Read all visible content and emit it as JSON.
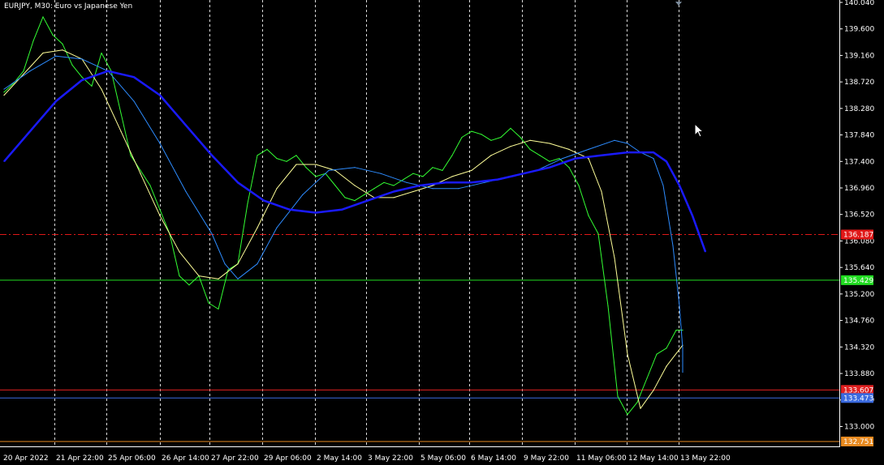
{
  "title": "EURJPY, M30:  Euro vs Japanese Yen",
  "colors": {
    "background": "#000000",
    "axis": "#ffffff",
    "grid": "#ffffff",
    "price": "#33ff33",
    "ma_fast": "#ffff99",
    "ma_mid": "#2d8cff",
    "ma_slow": "#1a1aff",
    "level_red_dash": "#e01818",
    "level_green": "#22dd22",
    "level_red": "#e02020",
    "level_blue": "#3a6adf",
    "level_orange": "#e88a20"
  },
  "chart_data": {
    "type": "line",
    "symbol": "EURJPY",
    "timeframe": "M30",
    "title": "EURJPY, M30:  Euro vs Japanese Yen",
    "ylim": [
      132.67,
      140.08
    ],
    "y_ticks": [
      "140.040",
      "139.600",
      "139.160",
      "138.720",
      "138.280",
      "137.840",
      "137.400",
      "136.960",
      "136.520",
      "136.080",
      "135.640",
      "135.200",
      "134.760",
      "134.320",
      "133.880",
      "133.440",
      "133.000"
    ],
    "x_ticks": [
      "20 Apr 2022",
      "21 Apr 22:00",
      "25 Apr 06:00",
      "26 Apr 14:00",
      "27 Apr 22:00",
      "29 Apr 06:00",
      "2 May 14:00",
      "3 May 22:00",
      "5 May 06:00",
      "6 May 14:00",
      "9 May 22:00",
      "11 May 06:00",
      "12 May 14:00",
      "13 May 22:00"
    ],
    "grid": "vertical-dashed",
    "price_levels": [
      {
        "label": "136.187",
        "value": 136.187,
        "style": "dash-dot",
        "color": "#e01818"
      },
      {
        "label": "135.429",
        "value": 135.429,
        "style": "solid",
        "color": "#22dd22"
      },
      {
        "label": "133.607",
        "value": 133.607,
        "style": "solid",
        "color": "#e02020"
      },
      {
        "label": "133.473",
        "value": 133.473,
        "style": "solid",
        "color": "#3a6adf"
      },
      {
        "label": "132.751",
        "value": 132.751,
        "style": "solid",
        "color": "#e88a20"
      }
    ],
    "series": [
      {
        "role": "price",
        "values": [
          138.55,
          138.7,
          138.9,
          139.4,
          139.8,
          139.5,
          139.35,
          139.0,
          138.8,
          138.65,
          139.2,
          138.9,
          138.2,
          137.5,
          137.25,
          137.0,
          136.6,
          136.2,
          135.5,
          135.35,
          135.5,
          135.05,
          134.95,
          135.6,
          135.7,
          136.7,
          137.5,
          137.6,
          137.45,
          137.4,
          137.5,
          137.3,
          137.15,
          137.2,
          137.0,
          136.8,
          136.75,
          136.85,
          136.95,
          137.05,
          137.0,
          137.1,
          137.2,
          137.15,
          137.3,
          137.25,
          137.5,
          137.8,
          137.9,
          137.85,
          137.75,
          137.8,
          137.95,
          137.8,
          137.6,
          137.5,
          137.4,
          137.45,
          137.3,
          137.0,
          136.5,
          136.2,
          135.0,
          133.5,
          133.2,
          133.4,
          133.8,
          134.2,
          134.3,
          134.6,
          134.6
        ],
        "x_index": [
          0,
          1.5,
          3,
          4.5,
          6,
          7.5,
          9,
          10.5,
          12,
          13.5,
          15,
          16.5,
          18,
          19.5,
          21,
          22.5,
          24,
          25.5,
          27,
          28.5,
          30,
          31.5,
          33,
          34.5,
          36,
          37.5,
          39,
          40.5,
          42,
          43.5,
          45,
          46.5,
          48,
          49.5,
          51,
          52.5,
          54,
          55.5,
          57,
          58.5,
          60,
          61.5,
          63,
          64.5,
          66,
          67.5,
          69,
          70.5,
          72,
          73.5,
          75,
          76.5,
          78,
          79.5,
          81,
          82.5,
          84,
          85.5,
          87,
          88.5,
          90,
          91.5,
          93,
          94.5,
          96,
          97.5,
          99,
          100.5,
          102,
          103.5,
          104.5
        ]
      },
      {
        "role": "fast moving average",
        "values": [
          138.5,
          138.85,
          139.2,
          139.25,
          139.1,
          138.6,
          137.9,
          137.2,
          136.5,
          135.9,
          135.5,
          135.45,
          135.7,
          136.3,
          136.95,
          137.35,
          137.35,
          137.25,
          137.0,
          136.8,
          136.8,
          136.9,
          137.0,
          137.15,
          137.25,
          137.5,
          137.65,
          137.75,
          137.7,
          137.6,
          137.45,
          136.9,
          135.8,
          134.2,
          133.3,
          133.6,
          134.0,
          134.35
        ],
        "x_index": [
          0,
          3,
          6,
          9,
          12,
          15,
          18,
          21,
          24,
          27,
          30,
          33,
          36,
          39,
          42,
          45,
          48,
          51,
          54,
          57,
          60,
          63,
          66,
          69,
          72,
          75,
          78,
          81,
          84,
          87,
          90,
          92,
          94,
          96,
          98,
          100,
          102,
          104.5
        ]
      },
      {
        "role": "mid moving average",
        "values": [
          138.6,
          138.9,
          139.15,
          139.1,
          138.9,
          138.4,
          137.7,
          136.9,
          136.2,
          135.7,
          135.45,
          135.7,
          136.3,
          136.85,
          137.25,
          137.3,
          137.2,
          137.05,
          136.95,
          136.95,
          137.05,
          137.15,
          137.25,
          137.45,
          137.6,
          137.75,
          137.7,
          137.55,
          137.45,
          137.0,
          136.0,
          135.0,
          134.3,
          133.9
        ],
        "x_index": [
          0,
          4,
          8,
          12,
          16,
          20,
          24,
          28,
          32,
          34,
          36,
          39,
          42,
          46,
          50,
          54,
          58,
          62,
          66,
          70,
          74,
          78,
          82,
          86,
          90,
          94,
          96,
          98,
          100,
          101.5,
          103,
          104,
          104.5,
          104.5
        ]
      },
      {
        "role": "slow moving average",
        "values": [
          137.4,
          137.9,
          138.4,
          138.75,
          138.9,
          138.8,
          138.5,
          138.0,
          137.5,
          137.05,
          136.75,
          136.6,
          136.55,
          136.6,
          136.75,
          136.9,
          137.0,
          137.05,
          137.05,
          137.1,
          137.2,
          137.3,
          137.45,
          137.5,
          137.55,
          137.55,
          137.4,
          137.0,
          136.5,
          135.9
        ],
        "x_index": [
          0,
          4,
          8,
          12,
          16,
          20,
          24,
          28,
          32,
          36,
          40,
          44,
          48,
          52,
          56,
          60,
          64,
          68,
          72,
          76,
          80,
          84,
          88,
          92,
          96,
          100,
          102,
          104,
          106,
          108
        ]
      }
    ]
  }
}
